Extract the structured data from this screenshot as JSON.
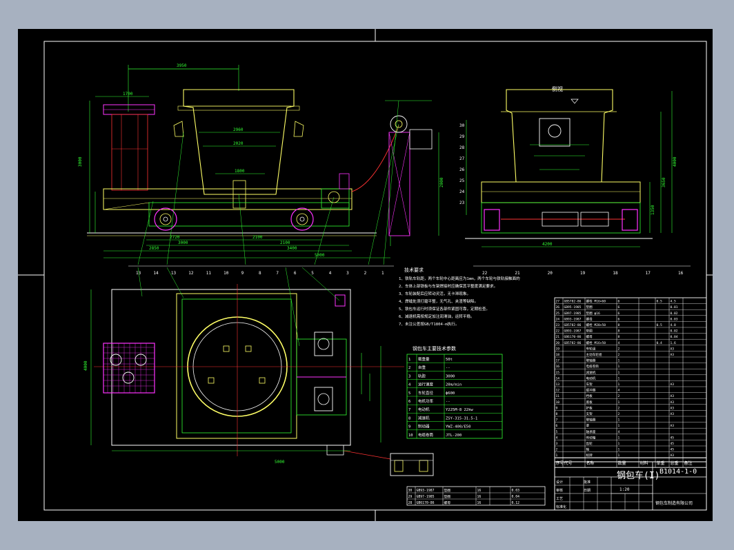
{
  "colors": {
    "background": "#a7b1c0",
    "paper": "#000000",
    "outline": "#ffffff",
    "yellow": "#ffff66",
    "green": "#33ff33",
    "red": "#ff3333",
    "magenta": "#ff33ff",
    "cyan": "#33ffff"
  },
  "labels": {
    "side_view_caption": "侧视",
    "tech_title": "技术要求",
    "tech_lines": [
      "1、铁轨车轨距，两个车轮中心距离应为1mm，两个车轮与铁轨接触面的",
      "2、车体上部铁板与车架焊接时应确保其平整度满足要求。",
      "3、车轮装配后应转动灵活，无卡滞现象。",
      "4、焊缝处须打磨平整，无气孔、夹渣等缺陷。",
      "5、铁包车运行时须保证各部件紧固可靠，定期检查。",
      "6、减速机需按规定加注润滑油，运转平稳。",
      "7、未注公差按GB/T1804-m执行。"
    ],
    "params_title": "钢包车主要技术参数",
    "drawing_title": "钢包车(I)",
    "drawing_number": "B1014-1-0"
  },
  "dimensions": {
    "top_overall": "3950",
    "top_inner": "1700",
    "ladle_w1": "2960",
    "ladle_w2": "2020",
    "ladle_w3": "1800",
    "base_1": "2720",
    "base_2": "2100",
    "base_3": "3000",
    "base_4": "2100",
    "base_5": "3400",
    "base_6": "2850",
    "base_7": "5000",
    "height_left": "3000",
    "height_right": "2000",
    "plan_width": "5000",
    "plan_height": "4000",
    "side_base": "4200",
    "side_h1": "4000",
    "side_h2": "3650",
    "side_h3": "1350"
  },
  "part_numbers_side": [
    "13",
    "14",
    "13",
    "12",
    "11",
    "10",
    "9",
    "8",
    "7",
    "6",
    "5",
    "4",
    "3",
    "2",
    "1"
  ],
  "part_numbers_end": [
    "22",
    "21",
    "20",
    "19",
    "18",
    "17",
    "16"
  ],
  "part_numbers_end_left": [
    "30",
    "29",
    "28",
    "27",
    "26",
    "25",
    "24",
    "23"
  ],
  "params_table": {
    "rows": [
      [
        "1",
        "载重量",
        "50t"
      ],
      [
        "2",
        "自重",
        "--"
      ],
      [
        "3",
        "轨距",
        "3000"
      ],
      [
        "4",
        "运行速度",
        "20m/min"
      ],
      [
        "5",
        "车轮直径",
        "ф600"
      ],
      [
        "6",
        "电机功率",
        "--"
      ],
      [
        "7",
        "电动机",
        "Y225M-8  22kw"
      ],
      [
        "8",
        "减速机",
        "ZSY-315-31.5-1"
      ],
      [
        "9",
        "制动器",
        "YWZ-400/E50"
      ],
      [
        "10",
        "电缆卷筒",
        "JTL-200"
      ]
    ]
  },
  "bom_rows": [
    [
      "27",
      "GB5782-86",
      "螺栓 M16×60",
      "6",
      "0.5",
      "4.5"
    ],
    [
      "26",
      "GB95-1985",
      "垫圈",
      "6",
      "",
      "0.01"
    ],
    [
      "25",
      "GB97-1985",
      "垫圈 ф16",
      "6",
      "",
      "0.02"
    ],
    [
      "24",
      "GB93-1987",
      "螺母",
      "6",
      "",
      "0.03"
    ],
    [
      "23",
      "GB5782-86",
      "螺栓 M20×50",
      "8",
      "0.5",
      "4.0"
    ],
    [
      "22",
      "GB93-1987",
      "垫圈",
      "8",
      "",
      "0.02"
    ],
    [
      "21",
      "GB6170-86",
      "螺母",
      "8",
      "",
      "0.04"
    ],
    [
      "20",
      "GB5782-86",
      "螺栓 M16×50",
      "4",
      "0.4",
      "1.6"
    ],
    [
      "19",
      "",
      "车轮组",
      "2",
      "",
      "A3"
    ],
    [
      "18",
      "",
      "主动车轮组",
      "2",
      "",
      "A3"
    ],
    [
      "17",
      "",
      "联轴器",
      "1",
      "",
      ""
    ],
    [
      "16",
      "",
      "电缆卷筒",
      "1",
      "",
      ""
    ],
    [
      "15",
      "",
      "减速机",
      "1",
      "",
      ""
    ],
    [
      "14",
      "",
      "电动机",
      "1",
      "",
      ""
    ],
    [
      "13",
      "",
      "车架",
      "1",
      "",
      "A3"
    ],
    [
      "12",
      "",
      "缓冲器",
      "4",
      "",
      ""
    ],
    [
      "11",
      "",
      "挡板",
      "2",
      "",
      "A3"
    ],
    [
      "10",
      "",
      "底板",
      "1",
      "",
      "A3"
    ],
    [
      "9",
      "",
      "护板",
      "2",
      "",
      "A3"
    ],
    [
      "8",
      "",
      "支架",
      "2",
      "",
      "A3"
    ],
    [
      "7",
      "",
      "联轴器",
      "1",
      "",
      ""
    ],
    [
      "6",
      "",
      "罩",
      "1",
      "",
      "A3"
    ],
    [
      "5",
      "",
      "轴承座",
      "4",
      "",
      ""
    ],
    [
      "4",
      "",
      "传动轴",
      "1",
      "",
      "45"
    ],
    [
      "3",
      "",
      "齿轮",
      "1",
      "",
      "45"
    ],
    [
      "2",
      "",
      "轴",
      "1",
      "",
      "45"
    ],
    [
      "1",
      "",
      "标牌",
      "1",
      "",
      "A3"
    ]
  ],
  "bom_header": [
    "序号",
    "代号",
    "名称",
    "数量",
    "材料",
    "单重",
    "总重",
    "备注"
  ],
  "title_block": {
    "company": "钢包车制造有限公司",
    "labels": [
      "设计",
      "审核",
      "工艺",
      "标准化",
      "批准",
      "日期"
    ],
    "scale": "1:20"
  },
  "small_bom_rows": [
    [
      "30",
      "GB93-1987",
      "垫圈",
      "16",
      "",
      "0.03"
    ],
    [
      "29",
      "GB97-1985",
      "垫圈",
      "16",
      "",
      "0.04"
    ],
    [
      "28",
      "GB6170-86",
      "螺母",
      "16",
      "",
      "0.12"
    ]
  ]
}
